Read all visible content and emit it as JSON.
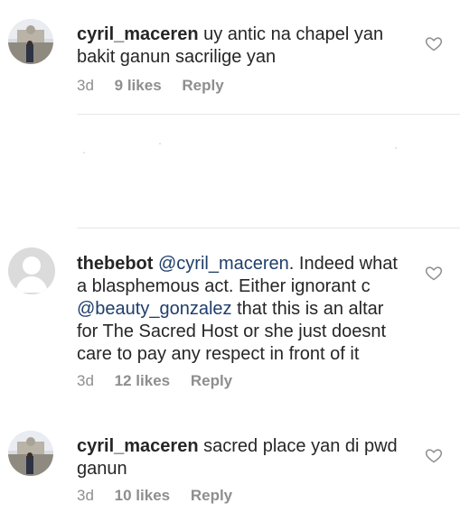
{
  "comments": [
    {
      "username": "cyril_maceren",
      "text": "uy antic na chapel yan bakit ganun sacrilige yan",
      "time": "3d",
      "likes": "9 likes",
      "reply": "Reply",
      "avatar": "photo"
    },
    {
      "username": "thebebot",
      "mention1": "@cyril_maceren",
      "text1": ". Indeed what a blasphemous act. Either ignorant c ",
      "mention2": "@beauty_gonzalez",
      "text2": " that this is an altar for The Sacred Host or she just doesnt care to pay any respect in front of it",
      "time": "3d",
      "likes": "12 likes",
      "reply": "Reply",
      "avatar": "default"
    },
    {
      "username": "cyril_maceren",
      "text": "sacred place yan di pwd ganun",
      "time": "3d",
      "likes": "10 likes",
      "reply": "Reply",
      "avatar": "photo"
    }
  ],
  "icons": {
    "like": "heart-outline-icon"
  },
  "colors": {
    "mention": "#1f3e6b",
    "meta": "#8e8e8e",
    "text": "#262626"
  }
}
